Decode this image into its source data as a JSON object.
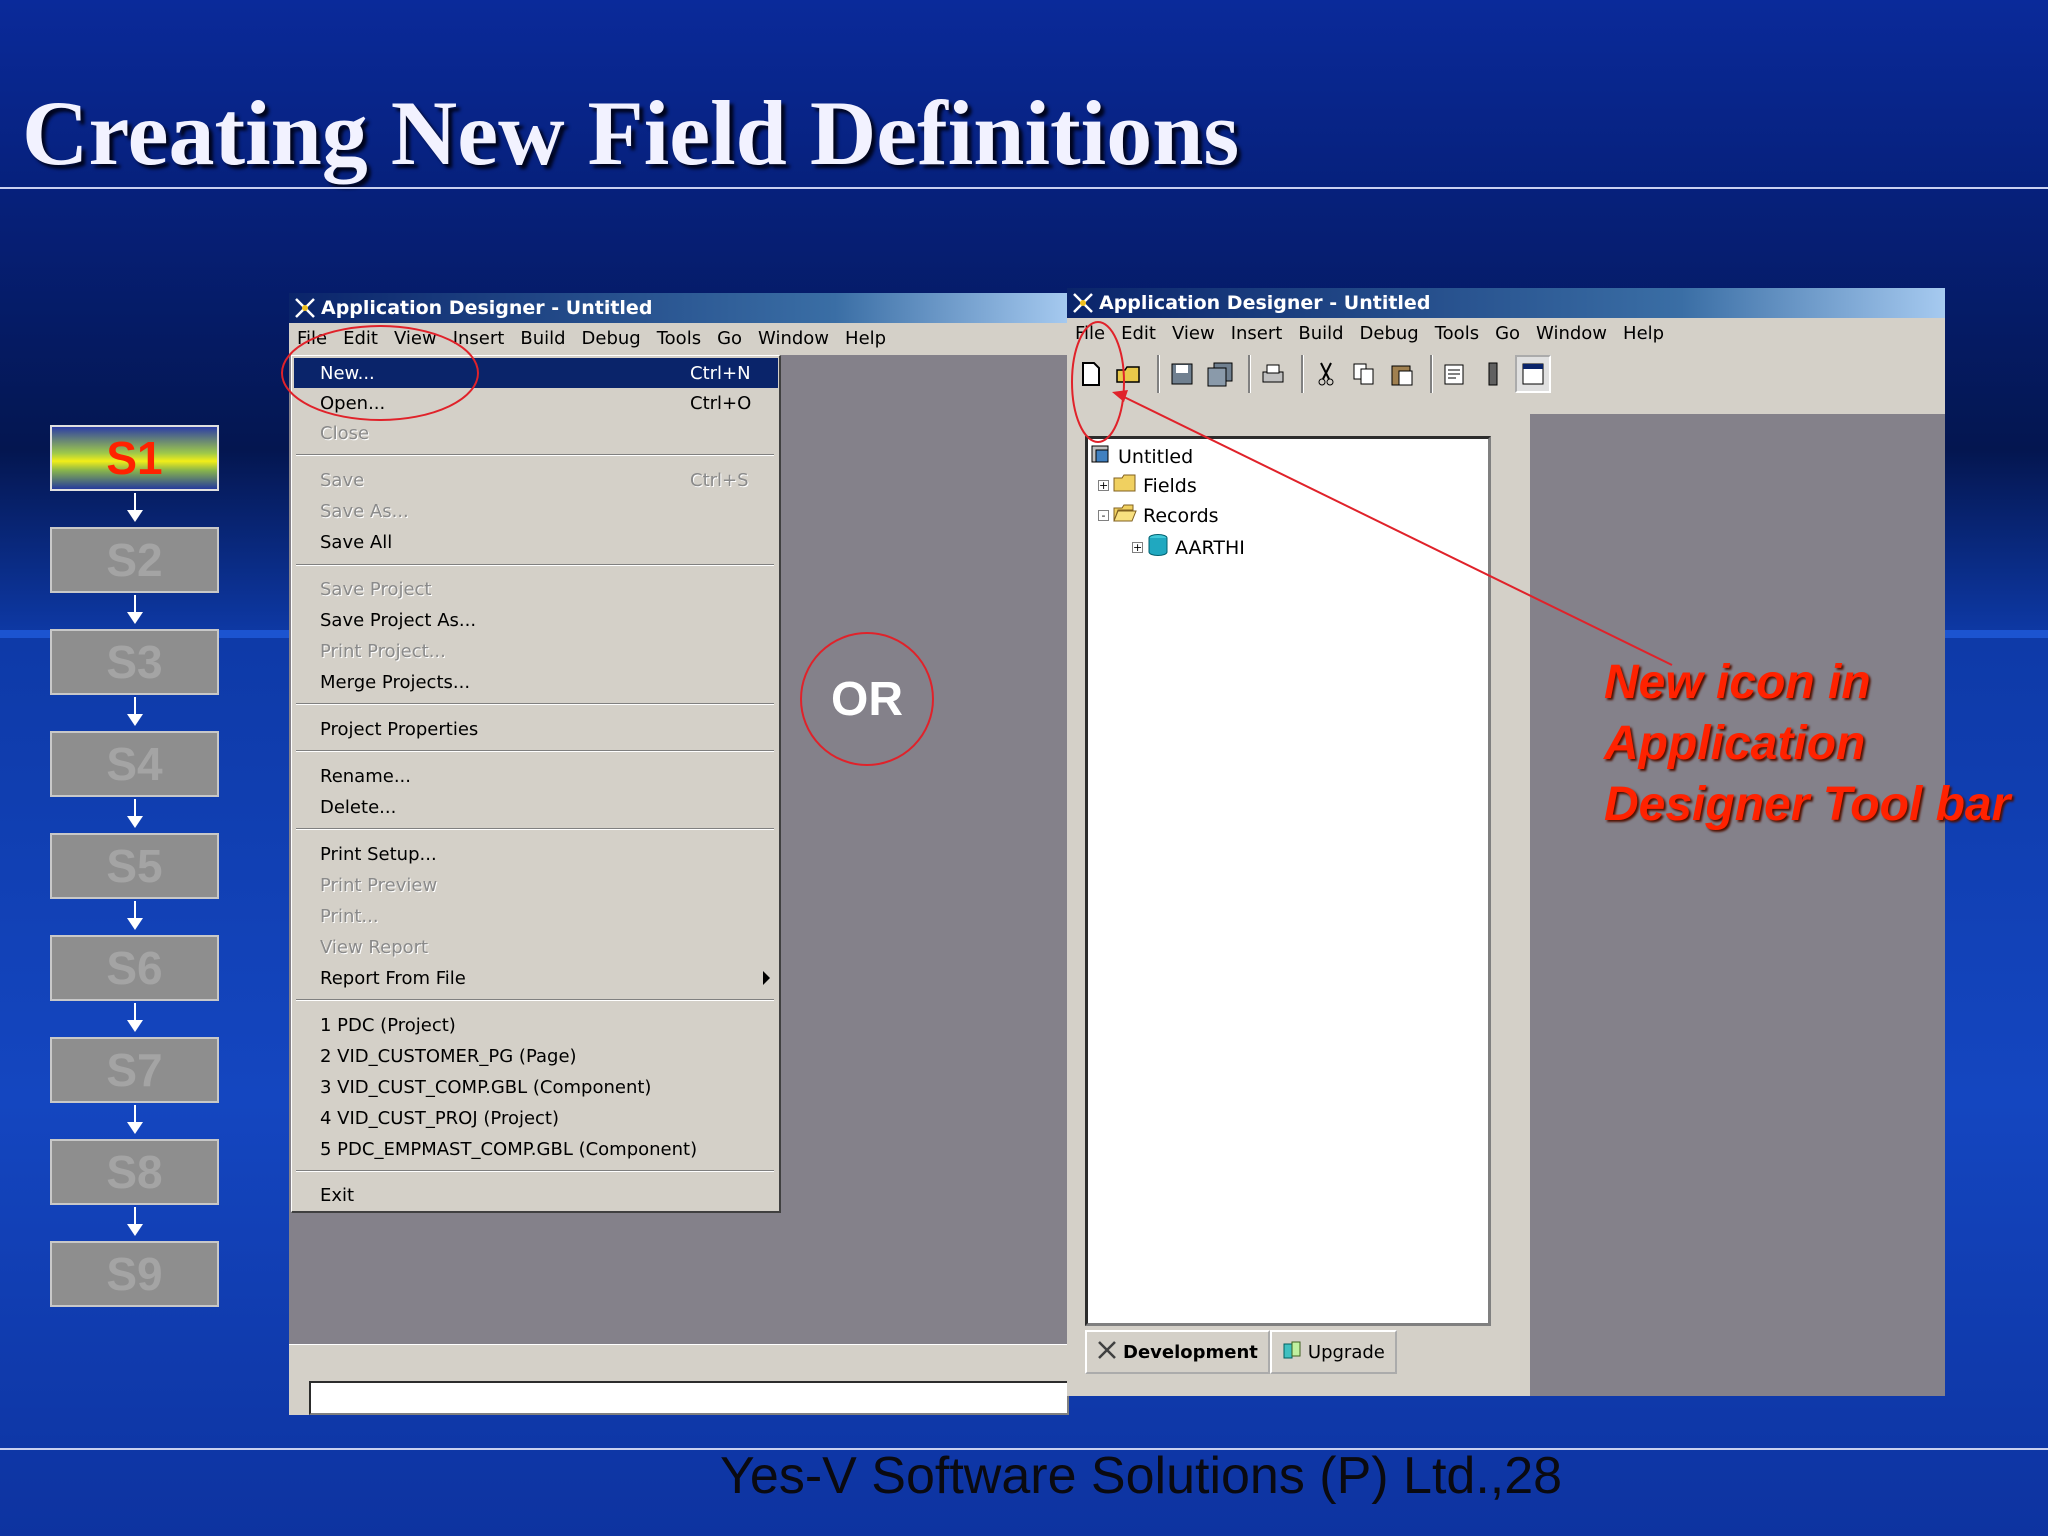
{
  "slide": {
    "title": "Creating New Field Definitions",
    "footer": "Yes-V Software Solutions (P) Ltd.,28",
    "or_label": "OR",
    "callout": "New icon in Application Designer Tool bar"
  },
  "steps": [
    {
      "label": "S1",
      "active": true
    },
    {
      "label": "S2",
      "active": false
    },
    {
      "label": "S3",
      "active": false
    },
    {
      "label": "S4",
      "active": false
    },
    {
      "label": "S5",
      "active": false
    },
    {
      "label": "S6",
      "active": false
    },
    {
      "label": "S7",
      "active": false
    },
    {
      "label": "S8",
      "active": false
    },
    {
      "label": "S9",
      "active": false
    }
  ],
  "left_window": {
    "title": "Application Designer - Untitled",
    "menu": [
      "File",
      "Edit",
      "View",
      "Insert",
      "Build",
      "Debug",
      "Tools",
      "Go",
      "Window",
      "Help"
    ],
    "file_menu": [
      {
        "label": "New...",
        "shortcut": "Ctrl+N",
        "state": "highlighted"
      },
      {
        "label": "Open...",
        "shortcut": "Ctrl+O",
        "state": "enabled"
      },
      {
        "label": "Close",
        "shortcut": "",
        "state": "disabled"
      },
      {
        "label": "Save",
        "shortcut": "Ctrl+S",
        "state": "disabled"
      },
      {
        "label": "Save As...",
        "shortcut": "",
        "state": "disabled"
      },
      {
        "label": "Save All",
        "shortcut": "",
        "state": "enabled"
      },
      {
        "label": "Save Project",
        "shortcut": "",
        "state": "disabled"
      },
      {
        "label": "Save Project As...",
        "shortcut": "",
        "state": "enabled"
      },
      {
        "label": "Print Project...",
        "shortcut": "",
        "state": "disabled"
      },
      {
        "label": "Merge Projects...",
        "shortcut": "",
        "state": "enabled"
      },
      {
        "label": "Project Properties",
        "shortcut": "",
        "state": "enabled"
      },
      {
        "label": "Rename...",
        "shortcut": "",
        "state": "enabled"
      },
      {
        "label": "Delete...",
        "shortcut": "",
        "state": "enabled"
      },
      {
        "label": "Print Setup...",
        "shortcut": "",
        "state": "enabled"
      },
      {
        "label": "Print Preview",
        "shortcut": "",
        "state": "disabled"
      },
      {
        "label": "Print...",
        "shortcut": "",
        "state": "disabled"
      },
      {
        "label": "View Report",
        "shortcut": "",
        "state": "disabled"
      },
      {
        "label": "Report From File",
        "shortcut": "",
        "state": "enabled",
        "submenu": true
      },
      {
        "label": "1 PDC (Project)",
        "shortcut": "",
        "state": "enabled"
      },
      {
        "label": "2 VID_CUSTOMER_PG (Page)",
        "shortcut": "",
        "state": "enabled"
      },
      {
        "label": "3 VID_CUST_COMP.GBL (Component)",
        "shortcut": "",
        "state": "enabled"
      },
      {
        "label": "4 VID_CUST_PROJ (Project)",
        "shortcut": "",
        "state": "enabled"
      },
      {
        "label": "5 PDC_EMPMAST_COMP.GBL (Component)",
        "shortcut": "",
        "state": "enabled"
      },
      {
        "label": "Exit",
        "shortcut": "",
        "state": "enabled"
      }
    ]
  },
  "right_window": {
    "title": "Application Designer - Untitled",
    "menu": [
      "File",
      "Edit",
      "View",
      "Insert",
      "Build",
      "Debug",
      "Tools",
      "Go",
      "Window",
      "Help"
    ],
    "toolbar_icons": [
      "new-icon",
      "open-icon",
      "save-icon",
      "save-all-icon",
      "print-icon",
      "cut-icon",
      "copy-icon",
      "paste-icon",
      "properties-icon",
      "build-icon",
      "project-workspace-icon"
    ],
    "tree": {
      "root": "Untitled",
      "nodes": [
        {
          "label": "Fields",
          "icon": "folder-icon",
          "expander": "+"
        },
        {
          "label": "Records",
          "icon": "folder-open-icon",
          "expander": "-"
        },
        {
          "label": "AARTHI",
          "icon": "database-icon",
          "expander": "+"
        }
      ]
    },
    "tabs": [
      "Development",
      "Upgrade"
    ]
  },
  "colors": {
    "annotation_red": "#e0222a",
    "callout_text": "#ff2200",
    "highlight_navy": "#0a246a"
  }
}
